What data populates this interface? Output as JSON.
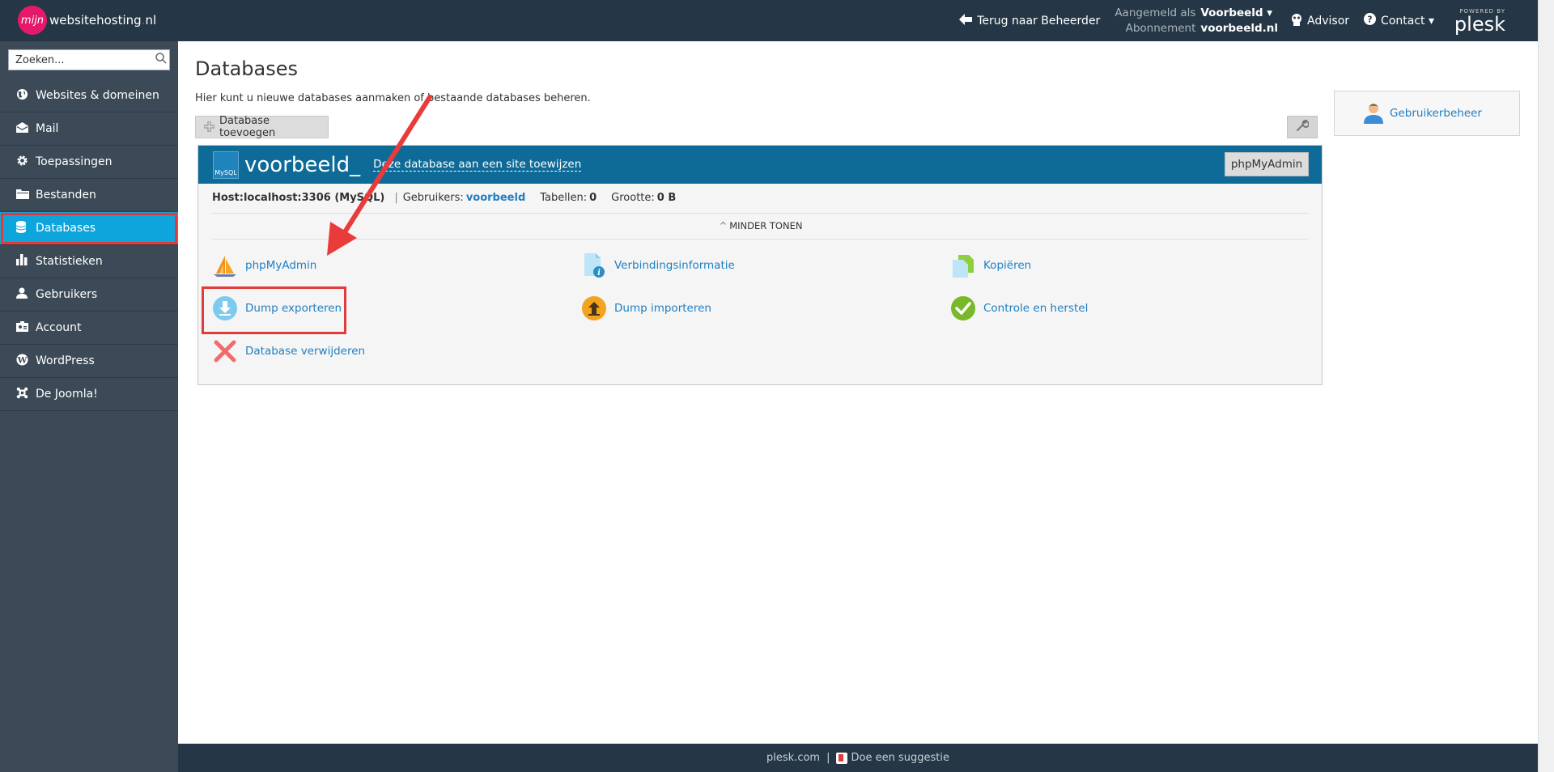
{
  "brand": {
    "logo_mark": "mijn",
    "name": "websitehosting",
    "suffix_dot": ".",
    "suffix": "nl"
  },
  "header": {
    "back_label": "Terug naar Beheerder",
    "logged_in_label": "Aangemeld als",
    "logged_in_user": "Voorbeeld ▾",
    "subscription_label": "Abonnement",
    "subscription_value": "voorbeeld.nl",
    "advisor_label": "Advisor",
    "contact_label": "Contact ▾",
    "powered_by": "POWERED BY",
    "plesk": "plesk"
  },
  "search": {
    "placeholder": "Zoeken..."
  },
  "sidebar": {
    "items": [
      {
        "label": "Websites & domeinen",
        "icon": "globe-icon"
      },
      {
        "label": "Mail",
        "icon": "mail-icon"
      },
      {
        "label": "Toepassingen",
        "icon": "gear-icon"
      },
      {
        "label": "Bestanden",
        "icon": "folder-icon"
      },
      {
        "label": "Databases",
        "icon": "database-icon",
        "active": true
      },
      {
        "label": "Statistieken",
        "icon": "bar-chart-icon"
      },
      {
        "label": "Gebruikers",
        "icon": "user-icon"
      },
      {
        "label": "Account",
        "icon": "id-card-icon"
      },
      {
        "label": "WordPress",
        "icon": "wordpress-icon"
      },
      {
        "label": "De Joomla!",
        "icon": "joomla-icon"
      }
    ]
  },
  "main": {
    "title": "Databases",
    "description": "Hier kunt u nieuwe databases aanmaken of bestaande databases beheren.",
    "add_button": "Database toevoegen"
  },
  "database": {
    "type_badge": "MySQL",
    "name": "voorbeeld_",
    "assign_link": "Deze database aan een site toewijzen",
    "phpmyadmin_button": "phpMyAdmin",
    "host": "Host:localhost:3306 (MySQL)",
    "users_label": "Gebruikers:",
    "users_value": "voorbeeld",
    "tables_label": "Tabellen:",
    "tables_value": "0",
    "size_label": "Grootte:",
    "size_value": "0 B",
    "toggle_label": "MINDER TONEN",
    "actions": {
      "phpmyadmin": "phpMyAdmin",
      "connection_info": "Verbindingsinformatie",
      "copy": "Kopiëren",
      "dump_export": "Dump exporteren",
      "dump_import": "Dump importeren",
      "check_repair": "Controle en herstel",
      "delete": "Database verwijderen"
    }
  },
  "right_panel": {
    "user_management": "Gebruikerbeheer"
  },
  "footer": {
    "plesk_link": "plesk.com",
    "separator": "|",
    "suggest": "Doe een suggestie"
  },
  "colors": {
    "topbar": "#253746",
    "sidebar": "#3b4a56",
    "accent": "#0ea5dc",
    "db_header": "#0e6b97",
    "highlight": "#e23b3b",
    "link": "#1e7fc2"
  }
}
